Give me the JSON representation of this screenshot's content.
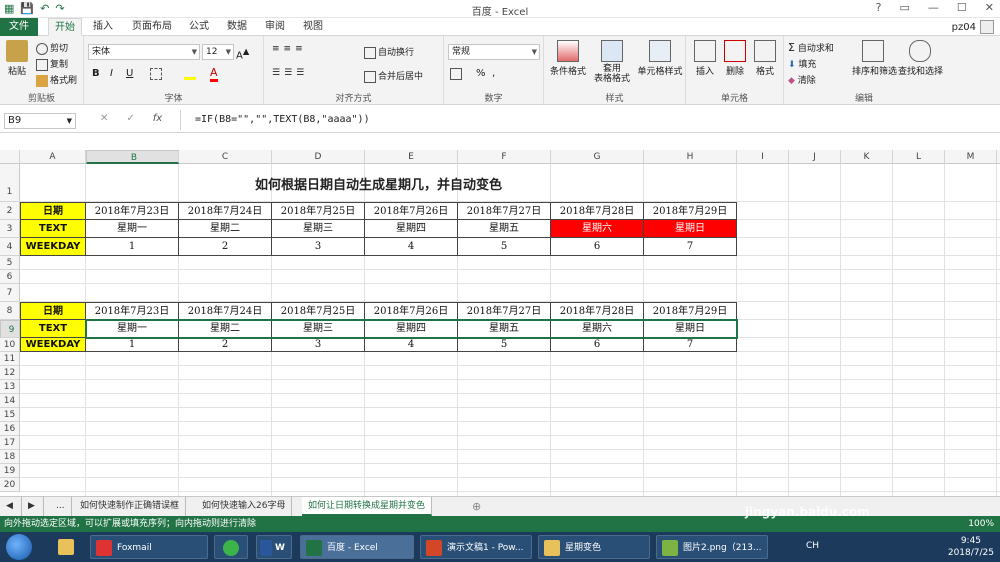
{
  "window": {
    "title": "百度 - Excel",
    "user": "pz04"
  },
  "ribbon_tabs": [
    "文件",
    "开始",
    "插入",
    "页面布局",
    "公式",
    "数据",
    "审阅",
    "视图"
  ],
  "ribbon": {
    "clipboard": {
      "paste": "粘贴",
      "cut": "剪切",
      "copy": "复制",
      "format_painter": "格式刷",
      "label": "剪贴板"
    },
    "font": {
      "name": "宋体",
      "size": "12",
      "bold": "B",
      "italic": "I",
      "underline": "U",
      "label": "字体"
    },
    "alignment": {
      "wrap": "自动换行",
      "merge": "合并后居中",
      "label": "对齐方式"
    },
    "number": {
      "format": "常规",
      "percent": "%",
      "comma": ",",
      "label": "数字"
    },
    "styles": {
      "conditional": "条件格式",
      "table": "套用\n表格格式",
      "cell_styles": "单元格样式",
      "label": "样式"
    },
    "cells": {
      "insert": "插入",
      "delete": "删除",
      "format": "格式",
      "label": "单元格"
    },
    "editing": {
      "autosum": "自动求和",
      "fill": "填充",
      "clear": "清除",
      "sort": "排序和筛选",
      "find": "查找和选择",
      "label": "编辑"
    }
  },
  "formula_bar": {
    "name_box": "B9",
    "formula": "=IF(B8=\"\",\"\",TEXT(B8,\"aaaa\"))"
  },
  "columns": [
    "A",
    "B",
    "C",
    "D",
    "E",
    "F",
    "G",
    "H",
    "I",
    "J",
    "K",
    "L",
    "M"
  ],
  "rows": [
    "1",
    "2",
    "3",
    "4",
    "5",
    "6",
    "7",
    "8",
    "9",
    "10",
    "11",
    "12",
    "13",
    "14",
    "15",
    "16",
    "17",
    "18",
    "19",
    "20"
  ],
  "sheet": {
    "title": "如何根据日期自动生成星期几，并自动变色",
    "labels": {
      "date": "日期",
      "text": "TEXT",
      "weekday": "WEEKDAY"
    },
    "dates": [
      "2018年7月23日",
      "2018年7月24日",
      "2018年7月25日",
      "2018年7月26日",
      "2018年7月27日",
      "2018年7月28日",
      "2018年7月29日"
    ],
    "weekdays": [
      "星期一",
      "星期二",
      "星期三",
      "星期四",
      "星期五",
      "星期六",
      "星期日"
    ],
    "numbers": [
      "1",
      "2",
      "3",
      "4",
      "5",
      "6",
      "7"
    ],
    "highlight_color": "#ff0000",
    "label_color": "#ffff00"
  },
  "sheet_tabs": [
    "...",
    "如何快速制作正确错误框",
    "如何快速输入26字母",
    "如何让日期转换成星期并变色"
  ],
  "active_sheet_tab": 3,
  "status": {
    "message": "向外拖动选定区域，可以扩展或填充序列；向内拖动则进行清除",
    "zoom": "100%"
  },
  "taskbar": {
    "items": [
      "Foxmail",
      "",
      "W",
      "百度 - Excel",
      "演示文稿1 - Pow...",
      "星期变色",
      "图片2.png（213..."
    ],
    "time": "9:45",
    "date": "2018/7/25",
    "lang": "CH"
  },
  "watermark": "jingyan.baidu.com"
}
